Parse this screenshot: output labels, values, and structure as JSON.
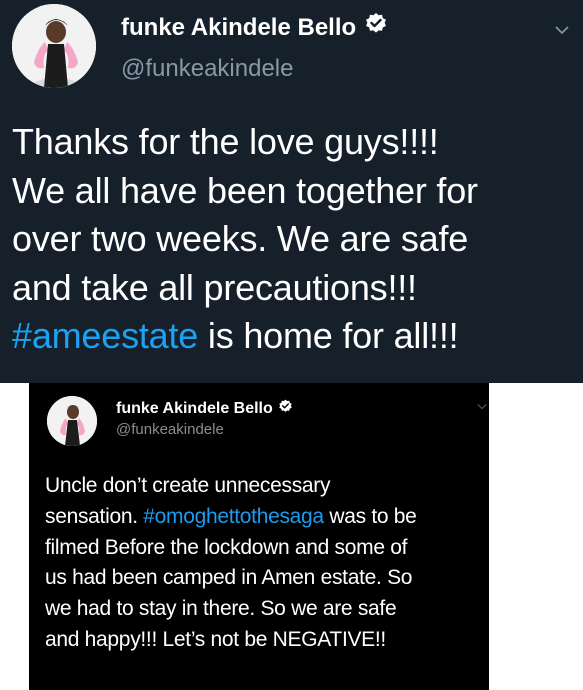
{
  "tweet_top": {
    "author_name": "funke Akindele Bello",
    "handle": "@funkeakindele",
    "text_lines": [
      "Thanks for the love guys!!!!",
      "We all have been together for",
      "over two weeks. We are safe",
      "and take all precautions!!!"
    ],
    "hashtag": "#ameestate",
    "hashtag_suffix": " is home for all!!!",
    "icons": {
      "verified": "verified-badge-icon",
      "menu": "chevron-down-icon"
    },
    "colors": {
      "background": "#15202b",
      "hashtag": "#1da1f2",
      "handle": "#8899a6"
    }
  },
  "tweet_bottom": {
    "author_name": "funke Akindele Bello",
    "handle": "@funkeakindele",
    "line1": "Uncle don’t create unnecessary",
    "line2_prefix": "sensation. ",
    "hashtag": "#omoghettothesaga",
    "line2_suffix": " was to be",
    "line3": "filmed Before the lockdown and some of",
    "line4": "us had been camped in Amen estate. So",
    "line5": "we had to stay in there. So we are safe",
    "line6": "and happy!!! Let’s not be NEGATIVE!!",
    "icons": {
      "verified": "verified-badge-icon",
      "menu": "chevron-down-icon"
    },
    "colors": {
      "background": "#000000",
      "hashtag": "#1d9bf0",
      "handle": "#8a8d91"
    }
  }
}
